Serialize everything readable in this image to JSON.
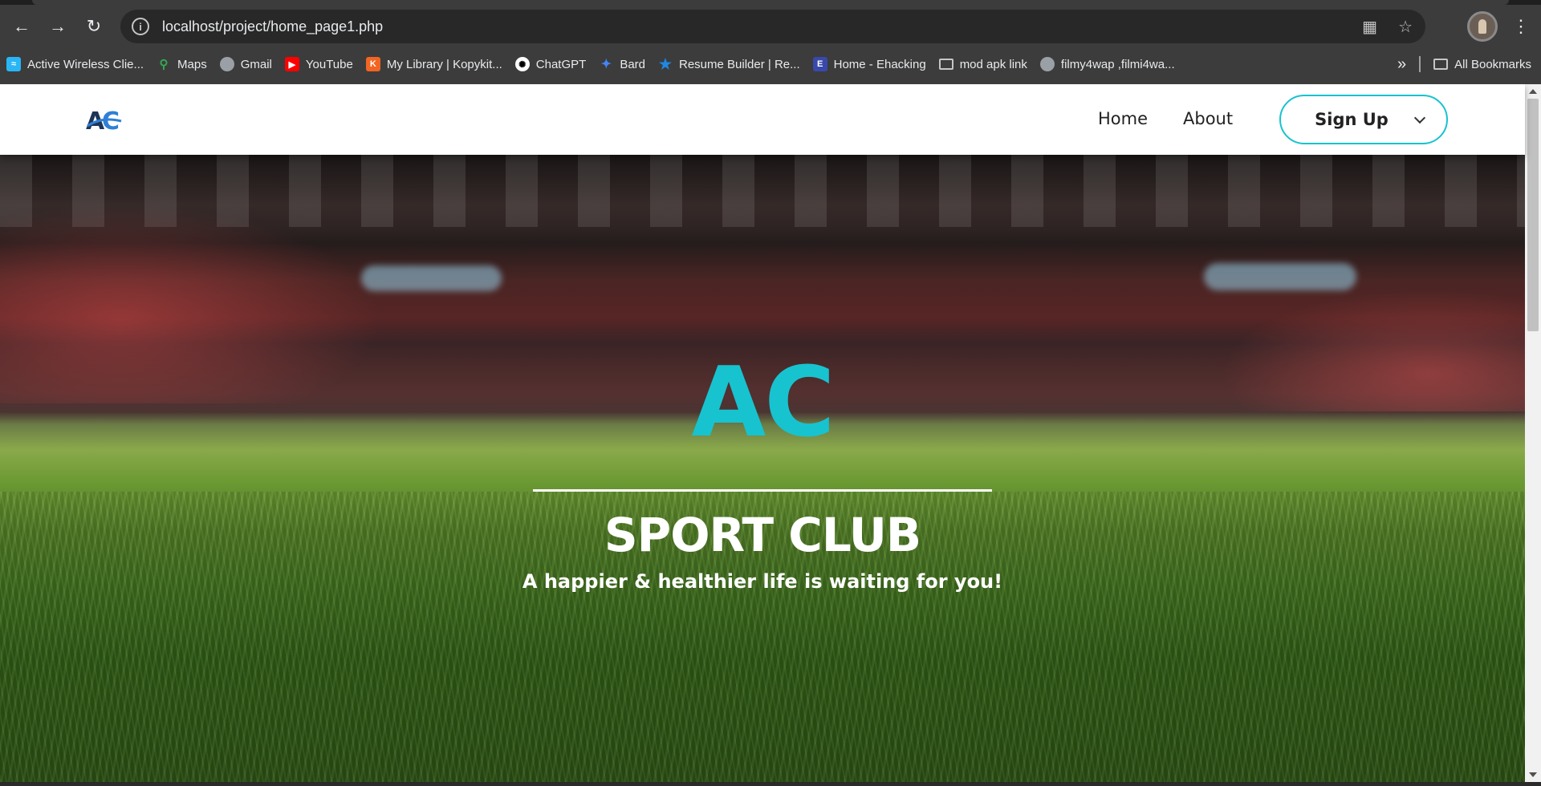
{
  "browser": {
    "url": "localhost/project/home_page1.php",
    "bookmarks": [
      {
        "label": "Active Wireless Clie...",
        "icon": "wireless-icon",
        "color": "#29b6f6"
      },
      {
        "label": "Maps",
        "icon": "maps-icon",
        "color": "#34a853"
      },
      {
        "label": "Gmail",
        "icon": "globe-icon",
        "color": "#9aa0a6"
      },
      {
        "label": "YouTube",
        "icon": "youtube-icon",
        "color": "#ff0000"
      },
      {
        "label": "My Library | Kopykit...",
        "icon": "kopykit-icon",
        "color": "#f26522"
      },
      {
        "label": "ChatGPT",
        "icon": "chatgpt-icon",
        "color": "#ffffff"
      },
      {
        "label": "Bard",
        "icon": "bard-icon",
        "color": "#4285f4"
      },
      {
        "label": "Resume Builder | Re...",
        "icon": "star-icon",
        "color": "#1e88e5"
      },
      {
        "label": "Home - Ehacking",
        "icon": "ehacking-icon",
        "color": "#3949ab"
      },
      {
        "label": "mod apk link",
        "icon": "folder-icon",
        "color": "#c6c6c6"
      },
      {
        "label": "filmy4wap ,filmi4wa...",
        "icon": "globe-icon",
        "color": "#9aa0a6"
      }
    ],
    "all_bookmarks": "All Bookmarks",
    "overflow": "»"
  },
  "site": {
    "logo_text": "AC",
    "nav": {
      "home": "Home",
      "about": "About",
      "signup": "Sign Up"
    },
    "hero": {
      "brand": "AC",
      "title": "SPORT CLUB",
      "subtitle": "A happier & healthier life is waiting for you!"
    }
  },
  "colors": {
    "accent": "#17c3cf",
    "logo_dark": "#1d3557",
    "logo_blue": "#2f7fd6"
  }
}
